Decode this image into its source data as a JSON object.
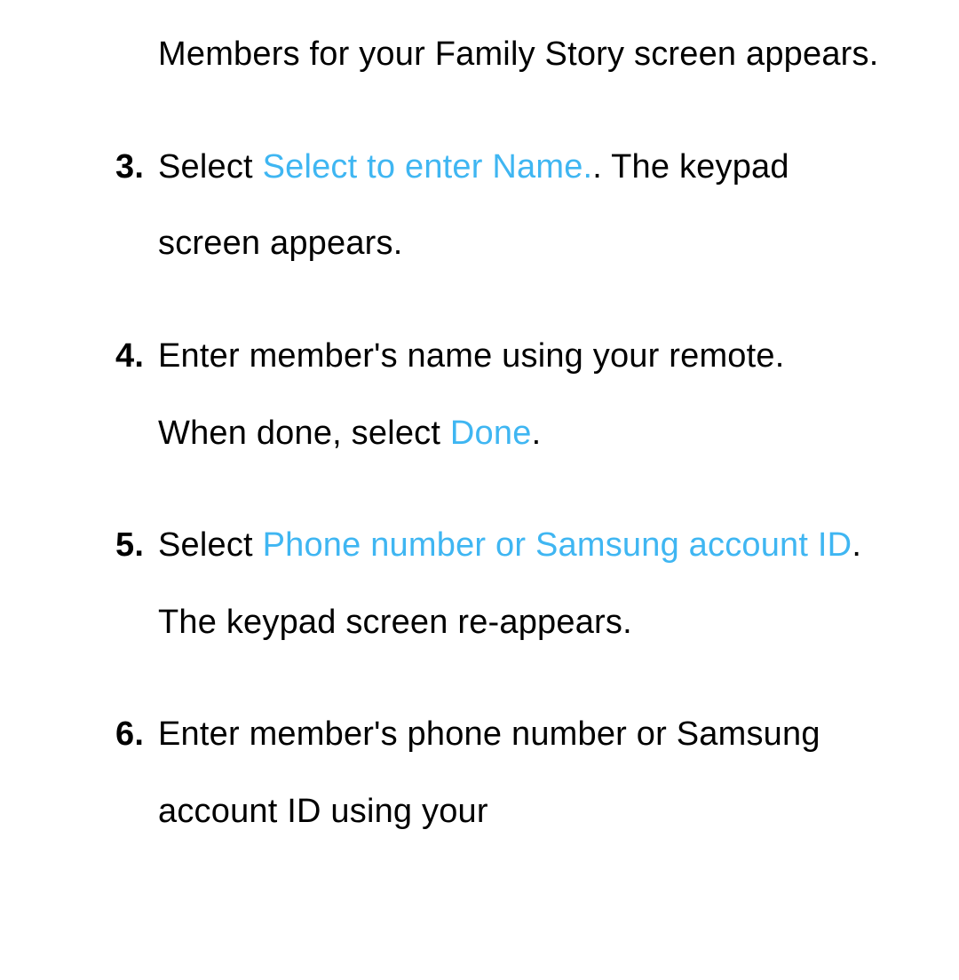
{
  "colors": {
    "highlight": "#3fb6f2",
    "text": "#000000",
    "background": "#ffffff"
  },
  "items": [
    {
      "marker": "",
      "segments": [
        {
          "type": "plain",
          "text": "Members for your Family Story screen appears."
        }
      ]
    },
    {
      "marker": "3.",
      "segments": [
        {
          "type": "plain",
          "text": "Select "
        },
        {
          "type": "hl",
          "text": "Select to enter Name."
        },
        {
          "type": "plain",
          "text": ". The keypad screen appears."
        }
      ]
    },
    {
      "marker": "4.",
      "segments": [
        {
          "type": "plain",
          "text": "Enter member's name using your remote. When done, select "
        },
        {
          "type": "hl",
          "text": "Done"
        },
        {
          "type": "plain",
          "text": "."
        }
      ]
    },
    {
      "marker": "5.",
      "segments": [
        {
          "type": "plain",
          "text": "Select "
        },
        {
          "type": "hl",
          "text": "Phone number or Samsung account ID"
        },
        {
          "type": "plain",
          "text": ". The keypad screen re-appears."
        }
      ]
    },
    {
      "marker": "6.",
      "segments": [
        {
          "type": "plain",
          "text": "Enter member's phone number or Samsung account ID using your"
        }
      ]
    }
  ]
}
